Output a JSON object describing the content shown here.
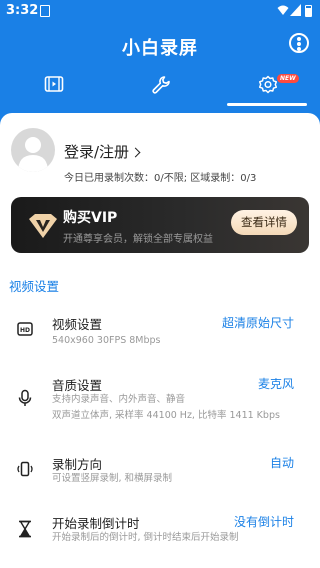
{
  "status_bar": {
    "time": "3:32"
  },
  "app": {
    "title": "小白录屏"
  },
  "tabs": [
    {
      "icon": "video-list-icon"
    },
    {
      "icon": "wrench-icon"
    },
    {
      "icon": "gear-icon",
      "badge": "NEW",
      "active": true
    }
  ],
  "profile": {
    "login_label": "登录/注册",
    "quota_text": "今日已用录制次数：0/不限; 区域录制：0/3"
  },
  "vip": {
    "title": "购买VIP",
    "subtitle": "开通尊享会员，解锁全部专属权益",
    "button_label": "查看详情"
  },
  "section": {
    "title": "视频设置"
  },
  "settings": [
    {
      "icon": "hd-icon",
      "label": "视频设置",
      "desc_lines": [
        "540x960  30FPS  8Mbps"
      ],
      "value": "超清原始尺寸"
    },
    {
      "icon": "microphone-icon",
      "label": "音质设置",
      "desc_lines": [
        "支持内录声音、内外声音、静音",
        "双声道立体声, 采样率 44100 Hz, 比特率 1411 Kbps"
      ],
      "value": "麦克风"
    },
    {
      "icon": "rotate-phone-icon",
      "label": "录制方向",
      "desc_lines": [
        "可设置竖屏录制, 和横屏录制"
      ],
      "value": "自动"
    },
    {
      "icon": "hourglass-icon",
      "label": "开始录制倒计时",
      "desc_lines": [
        "开始录制后的倒计时, 倒计时结束后开始录制"
      ],
      "value": "没有倒计时"
    }
  ],
  "colors": {
    "primary": "#1a80e6",
    "badge": "#ff4b3e",
    "vip_bg": "#1a1a1a",
    "vip_button": "#f4d9b8"
  }
}
